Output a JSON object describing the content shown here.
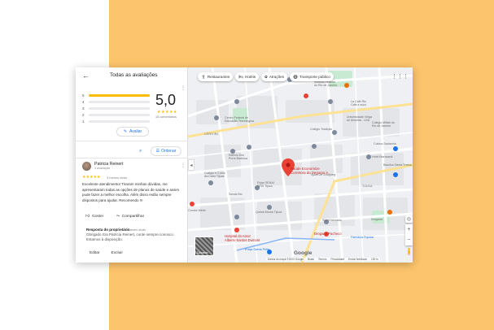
{
  "panel": {
    "title": "Todas as avaliações",
    "rating_bars": [
      {
        "label": "5",
        "fill": 1.0
      },
      {
        "label": "4",
        "fill": 0.0
      },
      {
        "label": "3",
        "fill": 0.0
      },
      {
        "label": "2",
        "fill": 0.0
      },
      {
        "label": "1",
        "fill": 0.0
      }
    ],
    "score": "5,0",
    "score_stars": "★★★★★",
    "score_count": "15 comentários",
    "rate_button": "Avaliar",
    "sort_button": "Ordenar"
  },
  "review": {
    "author": "Patricia Reinert",
    "author_sub": "1 avaliação",
    "stars": "★★★★★",
    "date": "3 meses atrás",
    "text": "Excelente atendimento! Tiraram minhas dúvidas, me apresentaram todas as opções de planos de saúde e assim pude fazer a melhor escolha. Além disso estão sempre dispostos para ajudar. Recomendo !!!",
    "like_label": "Gostei",
    "share_label": "Compartilhar",
    "owner_title": "Resposta do proprietário",
    "owner_date": "3 meses atrás",
    "owner_text": "Obrigado Sra Patrícia Reinert, conte sempre conosco. Estamos à disposição.",
    "edit_label": "Editar",
    "delete_label": "Excluir"
  },
  "map": {
    "chips": [
      {
        "icon": "restaurant-icon",
        "label": "Restaurantes"
      },
      {
        "icon": "hotel-icon",
        "label": "Hotéis"
      },
      {
        "icon": "attractions-icon",
        "label": "Atrações"
      },
      {
        "icon": "transit-icon",
        "label": "Transporte público"
      }
    ],
    "place_title_line1": "Saúde Economize",
    "place_title_line2": "Corretora de Seguros e...",
    "labels": {
      "instituto": "Instituto Federal",
      "instituto2": "do Rio de Janeiro",
      "cafe": "La Café Rio",
      "cafe_sub": "Café e suco",
      "universidade": "Universidade Veiga",
      "universidade2": "de Almeida - UVA",
      "centro": "Centro Federal de",
      "centro2": "Educação Tecnológica",
      "colegio_tradicao": "Colégio Tradição",
      "colegio_militar": "Colégio Militar do",
      "colegio_militar2": "Rio de Janeiro",
      "cefet": "CEFET/RJ",
      "edificio": "Edifício Dez",
      "edificio2": "Porto Barbosa",
      "tijuca_shopping": "Tijuca Off Shopping",
      "senai": "Firjan SENAI",
      "senai2": "SESI Tijuca",
      "colegio_curso": "Colégio e Curso",
      "colegio_curso2": "Ao Cubo Tijuca",
      "sonda": "Sonda Bio",
      "condor": "Condor Méier",
      "quinta": "Quinta Moura Tijuca",
      "tijuca": "TIJUCA",
      "hospital": "Hospital do Amor",
      "hospital2": "Alberto Santos Dumont",
      "drogaria": "Drogaria Pacheco",
      "drogaria2": "Drogaria",
      "praca": "Praça Saens Peña",
      "farmacia": "Farmácia Popular",
      "hotel": "Hotel Maracanã",
      "basilica": "Basílica Santa Teresa",
      "coluna": "Coluna Saldanha",
      "supermercado": "Supermercado",
      "footer_data": "Dados do mapa ©2023 Google",
      "footer_brasil": "Brasil",
      "footer_termos": "Termos",
      "footer_privacidade": "Privacidade",
      "footer_feedback": "Enviar feedback",
      "footer_scale": "100 m"
    },
    "layers_label": "Camadas",
    "google_logo": "Google"
  },
  "colors": {
    "accent": "#1a73e8",
    "star": "#fbbc04",
    "pin": "#ea4335",
    "background_orange": "#fcc46c"
  }
}
